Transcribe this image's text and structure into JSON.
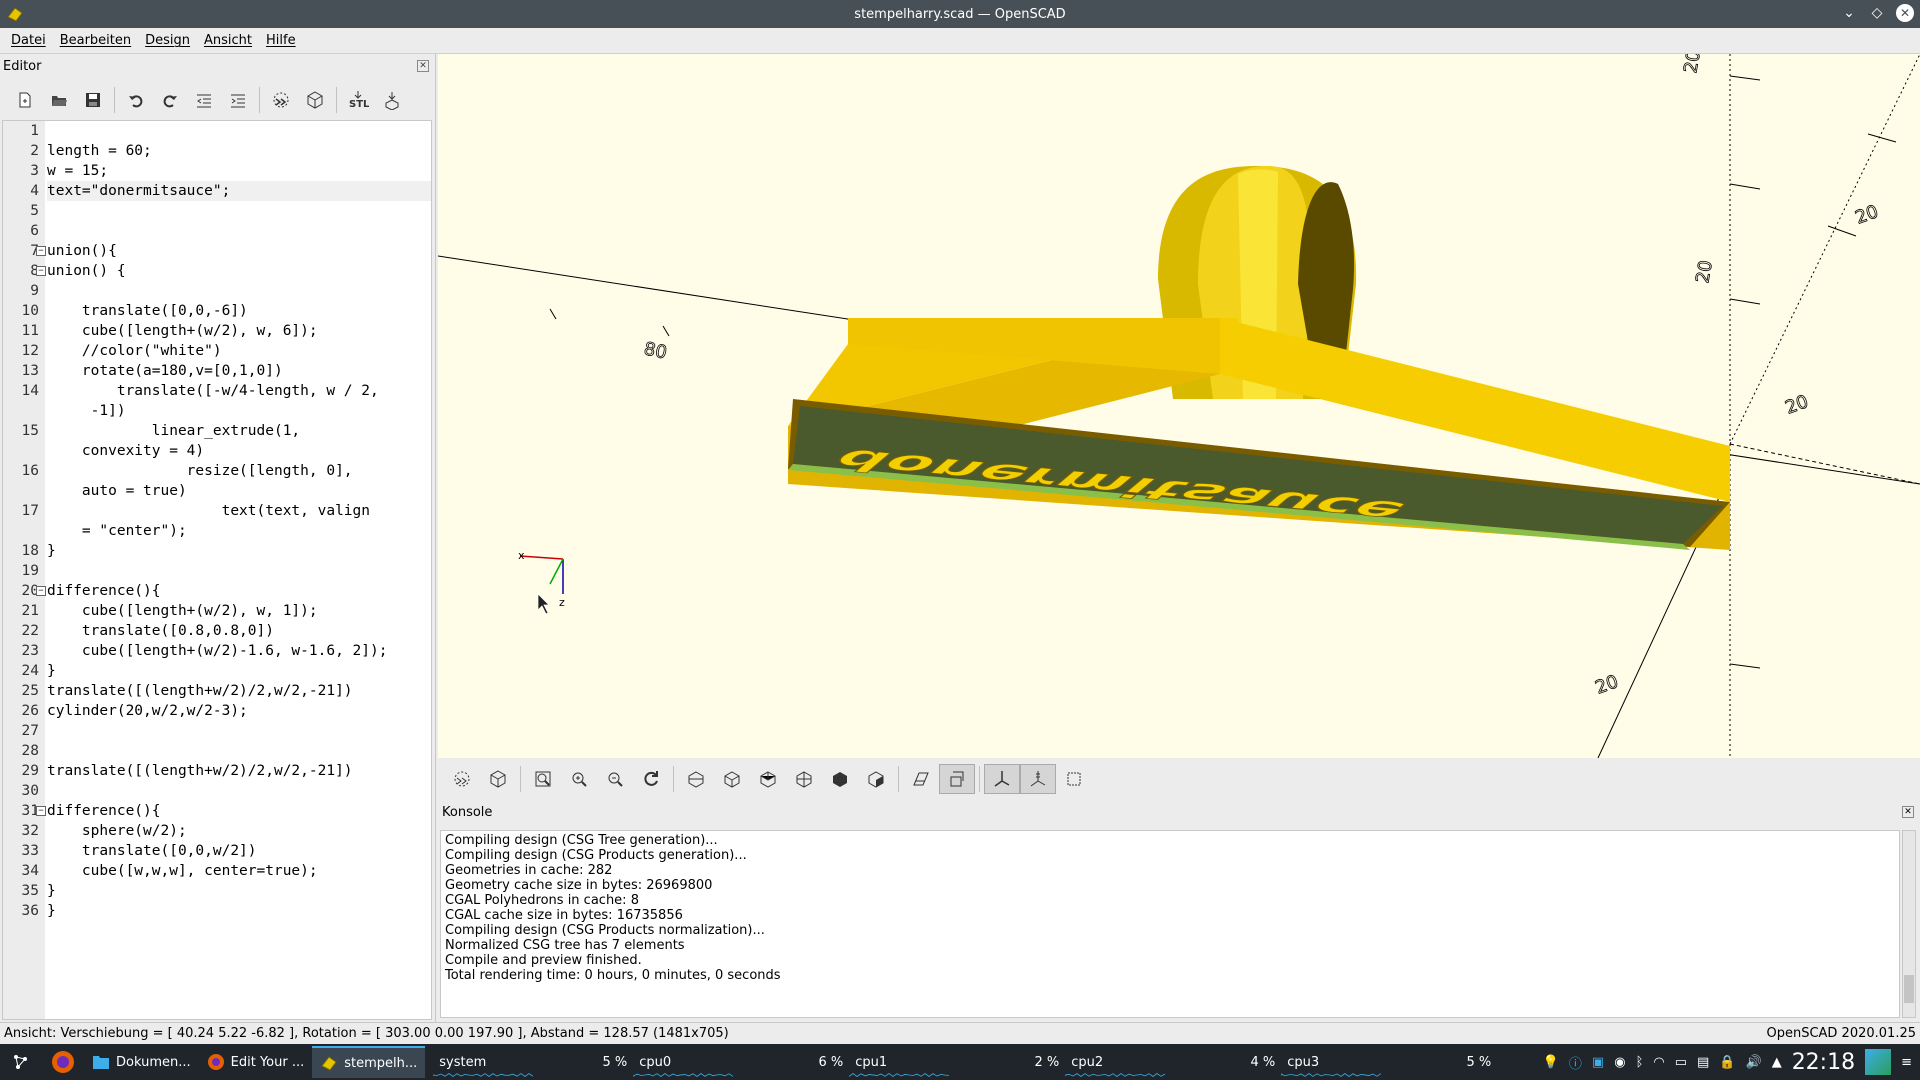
{
  "window": {
    "title": "stempelharry.scad — OpenSCAD"
  },
  "menu": [
    "Datei",
    "Bearbeiten",
    "Design",
    "Ansicht",
    "Hilfe"
  ],
  "editor": {
    "title": "Editor",
    "lines": [
      {
        "n": "1",
        "t": ""
      },
      {
        "n": "2",
        "t": "length = 60;"
      },
      {
        "n": "3",
        "t": "w = 15;"
      },
      {
        "n": "4",
        "t": "text=\"donermitsauce\";"
      },
      {
        "n": "5",
        "t": ""
      },
      {
        "n": "6",
        "t": ""
      },
      {
        "n": "7",
        "t": "union(){"
      },
      {
        "n": "8",
        "t": "union() {"
      },
      {
        "n": "9",
        "t": ""
      },
      {
        "n": "10",
        "t": "    translate([0,0,-6])"
      },
      {
        "n": "11",
        "t": "    cube([length+(w/2), w, 6]);"
      },
      {
        "n": "12",
        "t": "    //color(\"white\")"
      },
      {
        "n": "13",
        "t": "    rotate(a=180,v=[0,1,0])"
      },
      {
        "n": "14",
        "t": "        translate([-w/4-length, w / 2,"
      },
      {
        "n": "",
        "t": "     -1])"
      },
      {
        "n": "15",
        "t": "            linear_extrude(1,"
      },
      {
        "n": "",
        "t": "    convexity = 4)"
      },
      {
        "n": "16",
        "t": "                resize([length, 0],"
      },
      {
        "n": "",
        "t": "    auto = true)"
      },
      {
        "n": "17",
        "t": "                    text(text, valign"
      },
      {
        "n": "",
        "t": "    = \"center\");"
      },
      {
        "n": "18",
        "t": "}"
      },
      {
        "n": "19",
        "t": ""
      },
      {
        "n": "20",
        "t": "difference(){"
      },
      {
        "n": "21",
        "t": "    cube([length+(w/2), w, 1]);"
      },
      {
        "n": "22",
        "t": "    translate([0.8,0.8,0])"
      },
      {
        "n": "23",
        "t": "    cube([length+(w/2)-1.6, w-1.6, 2]);"
      },
      {
        "n": "24",
        "t": "}"
      },
      {
        "n": "25",
        "t": "translate([(length+w/2)/2,w/2,-21])"
      },
      {
        "n": "26",
        "t": "cylinder(20,w/2,w/2-3);"
      },
      {
        "n": "27",
        "t": ""
      },
      {
        "n": "28",
        "t": ""
      },
      {
        "n": "29",
        "t": "translate([(length+w/2)/2,w/2,-21])"
      },
      {
        "n": "30",
        "t": ""
      },
      {
        "n": "31",
        "t": "difference(){"
      },
      {
        "n": "32",
        "t": "    sphere(w/2);"
      },
      {
        "n": "33",
        "t": "    translate([0,0,w/2])"
      },
      {
        "n": "34",
        "t": "    cube([w,w,w], center=true);"
      },
      {
        "n": "35",
        "t": "}"
      },
      {
        "n": "36",
        "t": "}"
      }
    ]
  },
  "viewport": {
    "stamp_text": "donermitsauce",
    "axis_labels": {
      "x": "x",
      "z": "z"
    },
    "ruler_labels": [
      "80",
      "20",
      "20",
      "20",
      "20",
      "20"
    ]
  },
  "console": {
    "title": "Konsole",
    "lines": [
      "Compiling design (CSG Tree generation)...",
      "Compiling design (CSG Products generation)...",
      "Geometries in cache: 282",
      "Geometry cache size in bytes: 26969800",
      "CGAL Polyhedrons in cache: 8",
      "CGAL cache size in bytes: 16735856",
      "Compiling design (CSG Products normalization)...",
      "Normalized CSG tree has 7 elements",
      "Compile and preview finished.",
      "Total rendering time: 0 hours, 0 minutes, 0 seconds"
    ]
  },
  "status": {
    "left": "Ansicht: Verschiebung = [ 40.24 5.22 -6.82 ], Rotation = [ 303.00 0.00 197.90 ], Abstand = 128.57 (1481x705)",
    "right": "OpenSCAD 2020.01.25"
  },
  "taskbar": {
    "tasks": [
      "Dokumen...",
      "Edit Your ...",
      "stempelh..."
    ],
    "cpus": [
      {
        "pct": "5 %",
        "name": "system"
      },
      {
        "pct": "6 %",
        "name": "cpu0"
      },
      {
        "pct": "2 %",
        "name": "cpu1"
      },
      {
        "pct": "4 %",
        "name": "cpu2"
      },
      {
        "pct": "5 %",
        "name": "cpu3"
      }
    ],
    "clock": "22:18"
  },
  "colors": {
    "accent": "#3daee9",
    "viewport_bg": "#fffde8",
    "stamp_yellow": "#e6c400",
    "stamp_dark": "#4a5a2c"
  }
}
